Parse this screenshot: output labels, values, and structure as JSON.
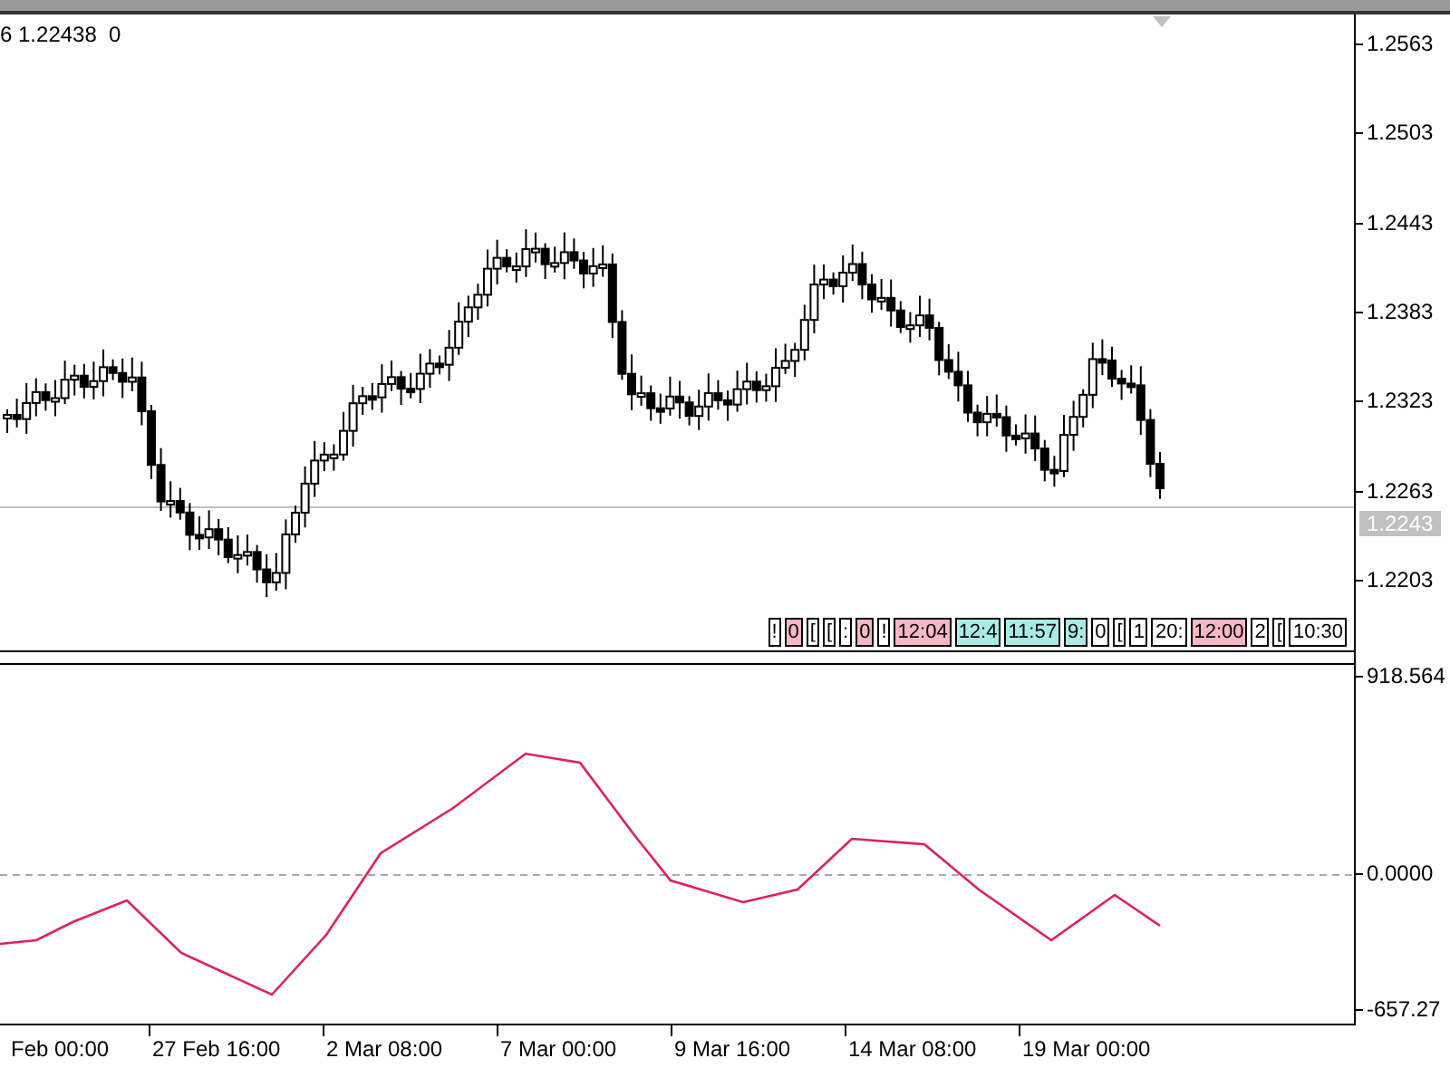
{
  "header": {
    "text": "6 1.22438  0"
  },
  "price_axis": {
    "ticks": [
      "1.2563",
      "1.2503",
      "1.2443",
      "1.2383",
      "1.2323",
      "1.2263",
      "1.2203"
    ],
    "current_price": "1.2243"
  },
  "event_tags": [
    {
      "text": "!",
      "color": "#ffffff"
    },
    {
      "text": "0",
      "color": "#f6b8c6"
    },
    {
      "text": "[",
      "color": "#ffffff"
    },
    {
      "text": "[",
      "color": "#ffffff"
    },
    {
      "text": ":",
      "color": "#ffffff"
    },
    {
      "text": "0",
      "color": "#f6b8c6"
    },
    {
      "text": "!",
      "color": "#ffffff"
    },
    {
      "text": "12:04",
      "color": "#f6b8c6"
    },
    {
      "text": "12:4",
      "color": "#a9ece6"
    },
    {
      "text": "11:57",
      "color": "#a9ece6"
    },
    {
      "text": "9:",
      "color": "#a9ece6"
    },
    {
      "text": "0",
      "color": "#ffffff"
    },
    {
      "text": "[",
      "color": "#ffffff"
    },
    {
      "text": "1",
      "color": "#ffffff"
    },
    {
      "text": "20:",
      "color": "#ffffff"
    },
    {
      "text": "12:00",
      "color": "#f6b8c6"
    },
    {
      "text": "2",
      "color": "#ffffff"
    },
    {
      "text": "[",
      "color": "#ffffff"
    },
    {
      "text": "10:30",
      "color": "#ffffff"
    }
  ],
  "indicator_axis": {
    "ticks": [
      "918.564",
      "0.0000",
      "-657.27"
    ]
  },
  "time_axis": {
    "labels": [
      "Feb 00:00",
      "27 Feb 16:00",
      "2 Mar 08:00",
      "7 Mar 00:00",
      "9 Mar 16:00",
      "14 Mar 08:00",
      "19 Mar 00:00"
    ]
  }
}
